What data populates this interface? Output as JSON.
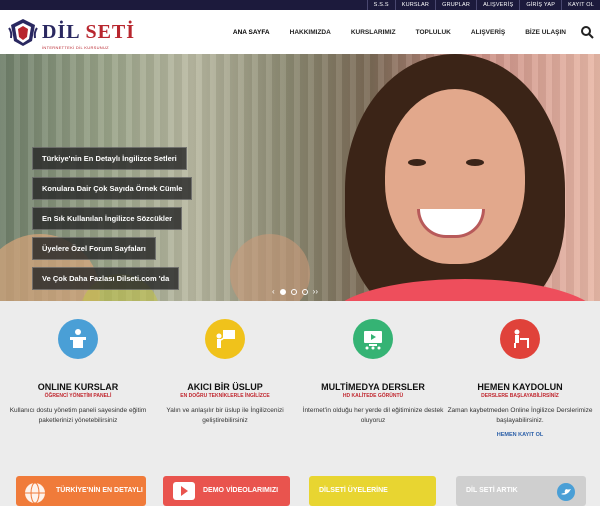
{
  "topbar": {
    "links": [
      "S.S.S",
      "KURSLAR",
      "GRUPLAR",
      "ALIŞVERİŞ",
      "GİRİŞ YAP",
      "KAYIT OL"
    ]
  },
  "header": {
    "logo_title_part1": "DİL",
    "logo_title_part2": "SETİ",
    "logo_subtitle": "İNTERNETTEKİ DİL KURSUNUZ",
    "nav": [
      "ANA SAYFA",
      "HAKKIMIZDA",
      "KURSLARIMIZ",
      "TOPLULUK",
      "ALIŞVERİŞ",
      "BİZE ULAŞIN"
    ],
    "active_nav": "ANA SAYFA",
    "search_icon": "search-icon"
  },
  "hero": {
    "features": [
      "Türkiye'nin En Detaylı İngilizce Setleri",
      "Konulara Dair Çok Sayıda Örnek Cümle",
      "En Sık Kullanılan İngilizce Sözcükler",
      "Üyelere Özel Forum Sayfaları",
      "Ve Çok Daha Fazlası Dilseti.com 'da"
    ],
    "slider": {
      "prev": "‹",
      "next": "››",
      "slides": 3,
      "active_slide": 1
    }
  },
  "services": [
    {
      "title": "ONLINE KURSLAR",
      "subtitle": "ÖĞRENCİ YÖNETİM PANELİ",
      "desc": "Kullanıcı dostu yönetim paneli sayesinde eğitim paketlerinizi yönetebilirsiniz",
      "color": "#4a9fd6",
      "icon": "podium-icon",
      "link": ""
    },
    {
      "title": "AKICI BİR ÜSLUP",
      "subtitle": "EN DOĞRU TEKNİKLERLE İNGİLİZCE",
      "desc": "Yalın ve anlaşılır bir üslup ile İngilizcenizi geliştirebilirsiniz",
      "color": "#f0c21b",
      "icon": "teacher-icon",
      "link": ""
    },
    {
      "title": "MULTİMEDYA DERSLER",
      "subtitle": "HD KALİTEDE GÖRÜNTÜ",
      "desc": "İnternet'in olduğu her yerde dil eğitiminize destek oluyoruz",
      "color": "#35b374",
      "icon": "monitor-icon",
      "link": ""
    },
    {
      "title": "HEMEN KAYDOLUN",
      "subtitle": "DERSLERE BAŞLAYABİLİRSİNİZ",
      "desc": "Zaman kaybetmeden Online İngilizce Derslerimize başlayabilirsiniz.",
      "color": "#e0423a",
      "icon": "desk-student-icon",
      "link": "HEMEN KAYIT OL"
    }
  ],
  "promos": [
    {
      "label": "TÜRKİYE'NİN EN DETAYLI",
      "color": "#f07b3a",
      "icon": "globe-icon"
    },
    {
      "label": "DEMO VİDEOLARIMIZI",
      "color": "#e9544e",
      "icon": "youtube-icon"
    },
    {
      "label": "DİLSETİ ÜYELERİNE",
      "color": "#e8d531",
      "icon": ""
    },
    {
      "label": "DİL SETİ ARTIK",
      "color": "#cfcfcf",
      "icon": "twitter-icon"
    }
  ]
}
